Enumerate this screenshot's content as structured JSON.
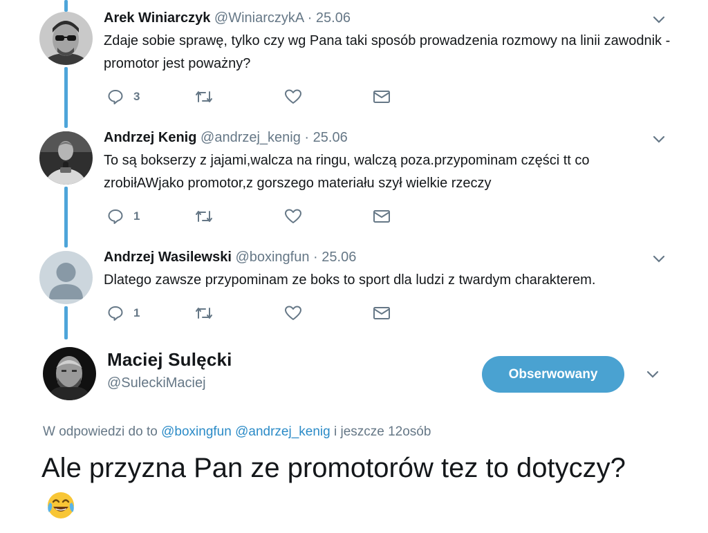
{
  "replies": [
    {
      "name": "Arek Winiarczyk",
      "handle": "@WiniarczykA",
      "separator": "·",
      "date": "25.06",
      "text": "Zdaje sobie sprawę, tylko czy wg Pana taki sposób prowadzenia rozmowy na linii zawodnik - promotor jest poważny?",
      "reply_count": "3",
      "avatar_icon": "man-with-sunglasses-avatar"
    },
    {
      "name": "Andrzej Kenig",
      "handle": "@andrzej_kenig",
      "separator": "·",
      "date": "25.06",
      "text": "To są bokserzy z jajami,walcza na ringu, walczą poza.przypominam części tt co zrobiłAWjako promotor,z gorszego materiału szył wielkie rzeczy",
      "reply_count": "1",
      "avatar_icon": "man-with-microphone-avatar"
    },
    {
      "name": "Andrzej Wasilewski",
      "handle": "@boxingfun",
      "separator": "·",
      "date": "25.06",
      "text": "Dlatego zawsze przypominam ze boks to sport dla ludzi z twardym charakterem.",
      "reply_count": "1",
      "avatar_icon": "default-user-avatar"
    }
  ],
  "main_tweet": {
    "name": "Maciej Sulęcki",
    "handle": "@SuleckiMaciej",
    "follow_label": "Obserwowany",
    "reply_prefix": "W odpowiedzi do to",
    "mention_1": "@boxingfun",
    "mention_2": "@andrzej_kenig",
    "reply_suffix": "i jeszcze 12osób",
    "text": "Ale przyzna Pan ze promotorów tez to dotyczy?",
    "emoji": "face-with-tears-of-joy-icon"
  },
  "colors": {
    "accent": "#4aa2d1",
    "thread_line": "#4ea5d9",
    "muted_text": "#657786",
    "link": "#2b8bc7"
  }
}
